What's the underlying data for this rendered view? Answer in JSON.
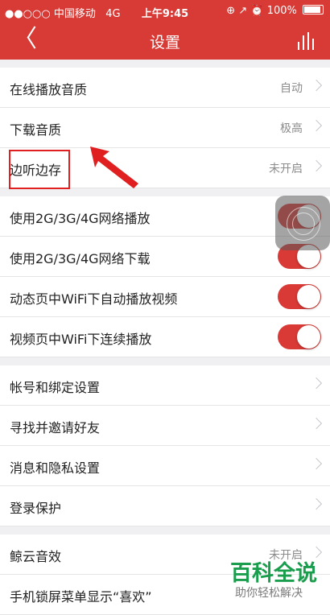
{
  "status_bar": {
    "signal": "●●○○○",
    "carrier": "中国移动",
    "network": "4G",
    "time": "上午9:45",
    "icons": "⊕ ↗ ⏰",
    "battery": "100%"
  },
  "nav": {
    "back": "〈",
    "title": "设置",
    "right_icon": "equalizer-icon"
  },
  "sections": [
    {
      "rows": [
        {
          "label": "在线播放音质",
          "value": "自动"
        },
        {
          "label": "下载音质",
          "value": "极高"
        },
        {
          "label": "边听边存",
          "value": "未开启"
        }
      ]
    },
    {
      "rows": [
        {
          "label": "使用2G/3G/4G网络播放",
          "toggle": true
        },
        {
          "label": "使用2G/3G/4G网络下载",
          "toggle": true
        },
        {
          "label": "动态页中WiFi下自动播放视频",
          "toggle": true
        },
        {
          "label": "视频页中WiFi下连续播放",
          "toggle": true
        }
      ]
    },
    {
      "rows": [
        {
          "label": "帐号和绑定设置"
        },
        {
          "label": "寻找并邀请好友"
        },
        {
          "label": "消息和隐私设置"
        },
        {
          "label": "登录保护"
        }
      ]
    },
    {
      "rows": [
        {
          "label": "鲸云音效",
          "value": "未开启"
        },
        {
          "label": "手机锁屏菜单显示“喜欢”"
        }
      ]
    }
  ],
  "watermark": {
    "title": "百科全说",
    "subtitle": "助你轻松解决"
  },
  "colors": {
    "brand_red": "#d83a36",
    "highlight_red": "#e02020",
    "watermark_green": "#1a9e4d"
  }
}
